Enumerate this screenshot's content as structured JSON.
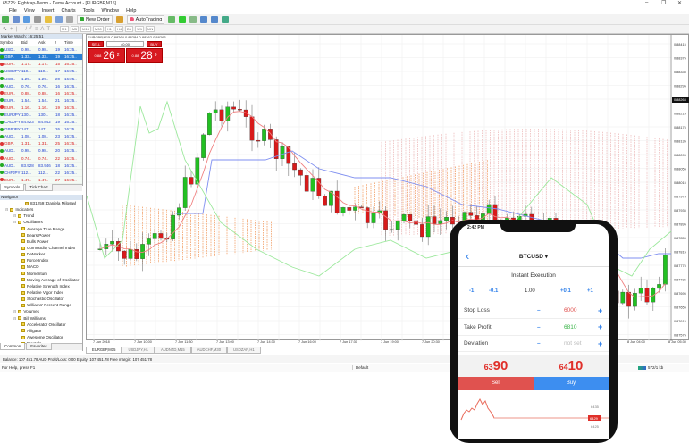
{
  "window": {
    "title": "65725: Eightcap-Demo - Demo Account - [EURGBP,M15]",
    "minimize": "–",
    "maximize": "❐",
    "close": "✕"
  },
  "menu": [
    "File",
    "View",
    "Insert",
    "Charts",
    "Tools",
    "Window",
    "Help"
  ],
  "toolbar": {
    "new_order": "New Order",
    "autotrading": "AutoTrading",
    "timeframes": [
      "M1",
      "M5",
      "M15",
      "M30",
      "H1",
      "H4",
      "D1",
      "W1",
      "MN"
    ]
  },
  "market_watch": {
    "title": "Market Watch: 16:25:51",
    "columns": [
      "Symbol",
      "Bid",
      "Ask",
      "!",
      "Time"
    ],
    "rows": [
      [
        "USD..",
        "0.98..",
        "0.98..",
        "19",
        "16:25..",
        "blue"
      ],
      [
        "GBP..",
        "1.33..",
        "1.33..",
        "19",
        "16:25..",
        "sel"
      ],
      [
        "EUR..",
        "1.17..",
        "1.17..",
        "15",
        "16:25..",
        "red"
      ],
      [
        "USDJPY",
        "110...",
        "110...",
        "17",
        "16:25..",
        "blue"
      ],
      [
        "USD..",
        "1.29..",
        "1.29..",
        "20",
        "16:25..",
        "blue"
      ],
      [
        "AUD..",
        "0.76..",
        "0.76..",
        "16",
        "16:25..",
        "blue"
      ],
      [
        "EUR..",
        "0.88..",
        "0.88..",
        "16",
        "16:25..",
        "red"
      ],
      [
        "EUR..",
        "1.54..",
        "1.54..",
        "21",
        "16:25..",
        "blue"
      ],
      [
        "EUR..",
        "1.16..",
        "1.16..",
        "19",
        "16:25..",
        "red"
      ],
      [
        "EURJPY",
        "130...",
        "130...",
        "18",
        "16:25..",
        "blue"
      ],
      [
        "CADJPY",
        "84.823",
        "84.842",
        "19",
        "16:25..",
        "blue"
      ],
      [
        "GBPJPY",
        "147...",
        "147...",
        "26",
        "16:25..",
        "blue"
      ],
      [
        "AUD..",
        "1.08..",
        "1.08..",
        "23",
        "16:25..",
        "blue"
      ],
      [
        "GBP..",
        "1.31..",
        "1.31..",
        "25",
        "16:25..",
        "red"
      ],
      [
        "AUD..",
        "0.98..",
        "0.98..",
        "20",
        "16:25..",
        "blue"
      ],
      [
        "AUD..",
        "0.74..",
        "0.74..",
        "22",
        "16:25..",
        "red"
      ],
      [
        "AUD..",
        "83.928",
        "83.946",
        "18",
        "16:25..",
        "blue"
      ],
      [
        "CHFJPY",
        "112...",
        "112...",
        "22",
        "16:25..",
        "blue"
      ],
      [
        "EUR..",
        "1.47..",
        "1.47..",
        "27",
        "16:25..",
        "red"
      ]
    ],
    "tabs": [
      "Symbols",
      "Tick Chart"
    ]
  },
  "navigator": {
    "title": "Navigator",
    "account": "831259: Daniela Milosavl",
    "items": [
      {
        "label": "Indicators",
        "level": 0
      },
      {
        "label": "Trend",
        "level": 1
      },
      {
        "label": "Oscillators",
        "level": 1
      },
      {
        "label": "Average True Range",
        "level": 2
      },
      {
        "label": "Bears Power",
        "level": 2
      },
      {
        "label": "Bulls Power",
        "level": 2
      },
      {
        "label": "Commodity Channel Index",
        "level": 2
      },
      {
        "label": "DeMarker",
        "level": 2
      },
      {
        "label": "Force Index",
        "level": 2
      },
      {
        "label": "MACD",
        "level": 2
      },
      {
        "label": "Momentum",
        "level": 2
      },
      {
        "label": "Moving Average of Oscillator",
        "level": 2
      },
      {
        "label": "Relative Strength Index",
        "level": 2
      },
      {
        "label": "Relative Vigor Index",
        "level": 2
      },
      {
        "label": "Stochastic Oscillator",
        "level": 2
      },
      {
        "label": "Williams' Percent Range",
        "level": 2
      },
      {
        "label": "Volumes",
        "level": 1
      },
      {
        "label": "Bill Williams",
        "level": 1
      },
      {
        "label": "Accelerator Oscillator",
        "level": 2
      },
      {
        "label": "Alligator",
        "level": 2
      },
      {
        "label": "Awesome Oscillator",
        "level": 2
      },
      {
        "label": "Fractals",
        "level": 2
      }
    ],
    "tabs": [
      "Common",
      "Favorites"
    ]
  },
  "chart": {
    "header": "EURGBP,M15  0.88264 0.88284 0.88262 0.88263",
    "trade_panel": {
      "sell": "SELL",
      "buy": "BUY",
      "volume": "40.00",
      "sell_prefix": "0.88",
      "sell_big": "26",
      "sell_sup": "2",
      "buy_prefix": "0.88",
      "buy_big": "28",
      "buy_sup": "9"
    },
    "price_labels": [
      "0.88415",
      "0.88375",
      "0.88335",
      "0.88295",
      "0.88263",
      "0.88215",
      "0.88175",
      "0.88135",
      "0.88095",
      "0.88055",
      "0.88015",
      "0.87975",
      "0.87935",
      "0.87895",
      "0.87855",
      "0.87815",
      "0.87775",
      "0.87735",
      "0.87695",
      "0.87655",
      "0.87615",
      "0.87575"
    ],
    "time_labels": [
      "7 Jun 2018",
      "7 Jun 10:00",
      "7 Jun 11:30",
      "7 Jun 13:00",
      "7 Jun 14:30",
      "7 Jun 16:00",
      "7 Jun 17:30",
      "7 Jun 19:00",
      "7 Jun 20:30",
      "7 Jun 22:00",
      "7 Jun 23:30",
      "8 Jun 01:00",
      "8 Jun 02:30",
      "8 Jun 04:00",
      "8 Jun 05:30"
    ],
    "tabs": [
      "EURGBP,M15",
      "USDJPY,H1",
      "AUDNZD,M15",
      "AUDCHF,M30",
      "USDZAR,H1"
    ]
  },
  "status": {
    "balance": "Balance: 107 451.78 AUD  Profit/Loss: 0.00  Equity: 107 451.78  Free margin: 107 451.78",
    "help": "For Help, press F1",
    "profile": "Default",
    "traffic": "572/1 kb"
  },
  "phone": {
    "time": "2:42 PM",
    "symbol": "BTCUSD ▾",
    "back": "‹",
    "mode": "Instant Execution",
    "steps": [
      "-1",
      "-0.1",
      "1.00",
      "+0.1",
      "+1"
    ],
    "rows": [
      {
        "label": "Stop Loss",
        "minus": "–",
        "value": "6000",
        "plus": "+",
        "color": "#e0524f"
      },
      {
        "label": "Take Profit",
        "minus": "–",
        "value": "6810",
        "plus": "+",
        "color": "#3bb54a"
      },
      {
        "label": "Deviation",
        "minus": "–",
        "value": "not set",
        "plus": "+",
        "color": "#bbbbbb"
      }
    ],
    "sell_prefix": "63",
    "sell_big": "90",
    "buy_prefix": "64",
    "buy_big": "10",
    "sell": "Sell",
    "buy": "Buy",
    "chart_labels": [
      "6435",
      "6429",
      "6425"
    ]
  },
  "colors": {
    "bull": "#22c022",
    "bear": "#d81a1a",
    "tenkan": "#f08080",
    "kijun": "#7f8ff0",
    "chikou": "#9be89b",
    "cloud": "#f4b183",
    "sell": "#e0524f",
    "buy": "#3d8ef0"
  }
}
